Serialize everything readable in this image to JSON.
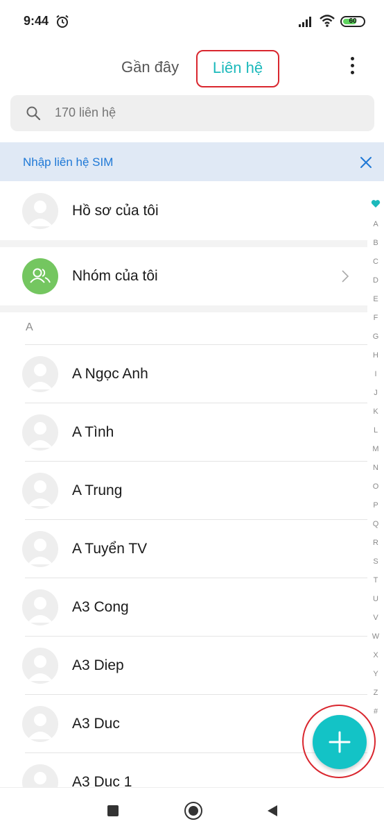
{
  "status_bar": {
    "time": "9:44",
    "battery": "60"
  },
  "header": {
    "tabs": [
      {
        "label": "Gần đây",
        "active": false
      },
      {
        "label": "Liên hệ",
        "active": true
      }
    ],
    "more_icon": "more-vertical-icon"
  },
  "search": {
    "placeholder": "170 liên hệ",
    "icon": "search-icon"
  },
  "sim_banner": {
    "text": "Nhập liên hệ SIM",
    "close_icon": "close-icon"
  },
  "profile": {
    "label": "Hồ sơ của tôi"
  },
  "groups": {
    "label": "Nhóm của tôi"
  },
  "section_letter": "A",
  "contacts": [
    {
      "name": "A Ngọc Anh"
    },
    {
      "name": "A Tình"
    },
    {
      "name": "A Trung"
    },
    {
      "name": "A Tuyển TV"
    },
    {
      "name": "A3 Cong"
    },
    {
      "name": "A3 Diep"
    },
    {
      "name": "A3 Duc"
    },
    {
      "name": "A3 Duc 1"
    }
  ],
  "alphabet_index": [
    "A",
    "B",
    "C",
    "D",
    "E",
    "F",
    "G",
    "H",
    "I",
    "J",
    "K",
    "L",
    "M",
    "N",
    "O",
    "P",
    "Q",
    "R",
    "S",
    "T",
    "U",
    "V",
    "W",
    "X",
    "Y",
    "Z",
    "#"
  ],
  "colors": {
    "accent": "#1bb9bb",
    "fab": "#13c3c6",
    "banner_bg": "#e0e9f5",
    "banner_text": "#1e78d6",
    "group_avatar": "#74c660",
    "highlight": "#d9262e"
  }
}
